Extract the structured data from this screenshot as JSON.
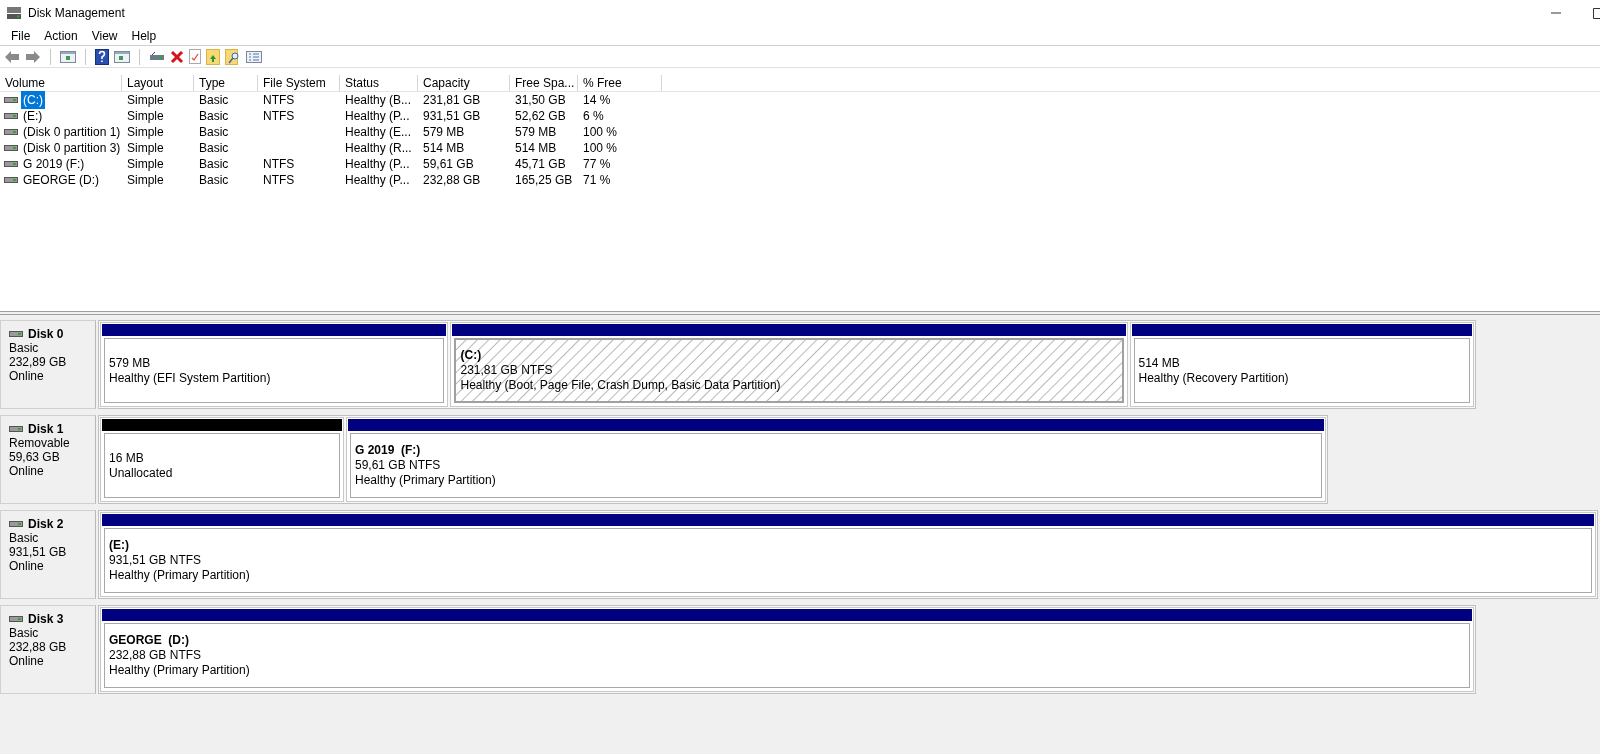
{
  "window": {
    "title": "Disk Management"
  },
  "menu": [
    "File",
    "Action",
    "View",
    "Help"
  ],
  "table": {
    "columns": [
      "Volume",
      "Layout",
      "Type",
      "File System",
      "Status",
      "Capacity",
      "Free Spa...",
      "% Free"
    ],
    "rows": [
      {
        "selected": true,
        "cells": [
          "(C:)",
          "Simple",
          "Basic",
          "NTFS",
          "Healthy (B...",
          "231,81 GB",
          "31,50 GB",
          "14 %"
        ]
      },
      {
        "selected": false,
        "cells": [
          "(E:)",
          "Simple",
          "Basic",
          "NTFS",
          "Healthy (P...",
          "931,51 GB",
          "52,62 GB",
          "6 %"
        ]
      },
      {
        "selected": false,
        "cells": [
          "(Disk 0 partition 1)",
          "Simple",
          "Basic",
          "",
          "Healthy (E...",
          "579 MB",
          "579 MB",
          "100 %"
        ]
      },
      {
        "selected": false,
        "cells": [
          "(Disk 0 partition 3)",
          "Simple",
          "Basic",
          "",
          "Healthy (R...",
          "514 MB",
          "514 MB",
          "100 %"
        ]
      },
      {
        "selected": false,
        "cells": [
          "G 2019 (F:)",
          "Simple",
          "Basic",
          "NTFS",
          "Healthy (P...",
          "59,61 GB",
          "45,71 GB",
          "77 %"
        ]
      },
      {
        "selected": false,
        "cells": [
          "GEORGE (D:)",
          "Simple",
          "Basic",
          "NTFS",
          "Healthy (P...",
          "232,88 GB",
          "165,25 GB",
          "71 %"
        ]
      }
    ]
  },
  "disks": [
    {
      "name": "Disk 0",
      "type": "Basic",
      "size": "232,89 GB",
      "status": "Online",
      "partitions": [
        {
          "kind": "primary",
          "selected": false,
          "size": "579 MB",
          "status": "Healthy (EFI System Partition)"
        },
        {
          "kind": "primary",
          "selected": true,
          "label": "(C:)",
          "size": "231,81 GB NTFS",
          "status": "Healthy (Boot, Page File, Crash Dump, Basic Data Partition)"
        },
        {
          "kind": "primary",
          "selected": false,
          "size": "514 MB",
          "status": "Healthy (Recovery Partition)"
        }
      ]
    },
    {
      "name": "Disk 1",
      "type": "Removable",
      "size": "59,63 GB",
      "status": "Online",
      "partitions": [
        {
          "kind": "unallocated",
          "selected": false,
          "size": "16 MB",
          "status": "Unallocated"
        },
        {
          "kind": "primary",
          "selected": false,
          "label": "G 2019  (F:)",
          "size": "59,61 GB NTFS",
          "status": "Healthy (Primary Partition)"
        }
      ]
    },
    {
      "name": "Disk 2",
      "type": "Basic",
      "size": "931,51 GB",
      "status": "Online",
      "partitions": [
        {
          "kind": "primary",
          "selected": false,
          "label": "(E:)",
          "size": "931,51 GB NTFS",
          "status": "Healthy (Primary Partition)"
        }
      ]
    },
    {
      "name": "Disk 3",
      "type": "Basic",
      "size": "232,88 GB",
      "status": "Online",
      "partitions": [
        {
          "kind": "primary",
          "selected": false,
          "label": "GEORGE  (D:)",
          "size": "232,88 GB NTFS",
          "status": "Healthy (Primary Partition)"
        }
      ]
    }
  ]
}
